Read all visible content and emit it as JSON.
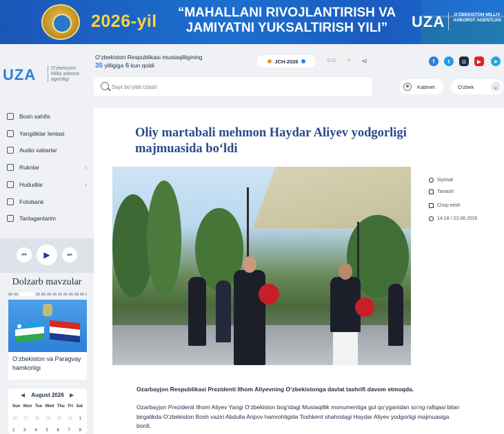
{
  "banner": {
    "year": "2026-yil",
    "title": "“MAHALLANI RIVOJLANTIRISH VA JAMIYATNI YUKSALTIRISH YILI”",
    "brand": "UZA",
    "agency": "O'ZBEKISTON MILLIY AXBOROT AGENTLIGI"
  },
  "header": {
    "logo_brand": "UZA",
    "logo_text": "O'zbekiston Milliy axborot agentligi",
    "independence_line1": "O‘zbekiston Respublikasi mustaqilligining",
    "independence_years": "35",
    "independence_mid": "yilligiga",
    "independence_days": "6",
    "independence_end": "kun qoldi",
    "badge": "JCH-2026",
    "search_placeholder": "Sayt bo‘ylab izlash",
    "cabinet_label": "Kabinet",
    "language": "O'zbek"
  },
  "sidebar": {
    "items": [
      {
        "label": "Bosh sahifa",
        "icon": "home-grid-icon"
      },
      {
        "label": "Yangiliklar lentasi",
        "icon": "news-feed-icon"
      },
      {
        "label": "Audio xabarlar",
        "icon": "audio-icon"
      },
      {
        "label": "Ruknlar",
        "icon": "list-icon",
        "arrow": "›"
      },
      {
        "label": "Hududlar",
        "icon": "map-icon",
        "arrow": "›"
      },
      {
        "label": "Fotobank",
        "icon": "photo-icon"
      },
      {
        "label": "Tanlaganlarim",
        "icon": "bookmark-icon"
      }
    ],
    "player": {
      "prev": "⏮",
      "play": "▶",
      "next": "⏭"
    },
    "topics_title": "Dolzarb mavzular",
    "topic_card_caption": "O‘zbekiston va Paragvay hamkorligi",
    "calendar": {
      "month": "August 2026",
      "prev_arrow": "◀",
      "next_arrow": "▶",
      "days": [
        "Sun",
        "Mon",
        "Tue",
        "Wed",
        "Thu",
        "Fri",
        "Sat"
      ],
      "row1": [
        "26",
        "27",
        "28",
        "29",
        "30",
        "31",
        "1"
      ],
      "row2": [
        "2",
        "3",
        "4",
        "5",
        "6",
        "7",
        "8"
      ]
    }
  },
  "article": {
    "title": "Oliy martabali mehmon Haydar Aliyev yodgorligi majmuasida bo‘ldi",
    "category": "Siyosat",
    "save_label": "Tanlash",
    "print_label": "Chop etish",
    "datetime": "14:18 / 23.08.2026",
    "lead": "Ozarbayjon Respublikasi Prezidenti Ilhom Aliyevning O‘zbekistonga davlat tashrifi davom etmoqda.",
    "body": "Ozarbayjon Prezidenti Ilhom Aliyev Yangi O‘zbekiston bog‘idagi Mustaqillik monumentiga gul qo‘yganidan so‘ng rafiqasi bilan birgalikda O‘zbekiston Bosh vaziri Abdulla Aripov hamrohligida Toshkent shahridagi Haydar Aliyev yodgorligi majmuasiga bordi."
  },
  "colors": {
    "accent": "#2e7fd9",
    "banner": "#1c6fd0",
    "title": "#2a4a8a"
  }
}
